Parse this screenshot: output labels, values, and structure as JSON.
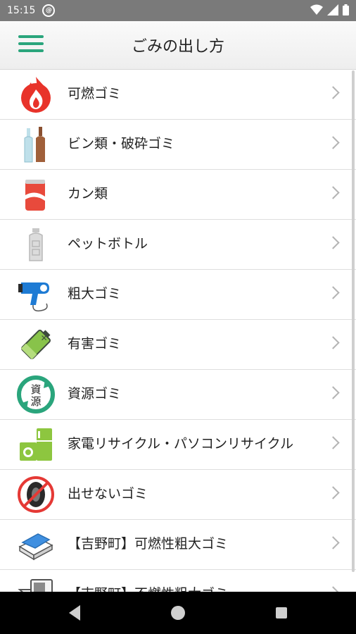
{
  "status_bar": {
    "time": "15:15",
    "sync_glyph": "@"
  },
  "app_bar": {
    "title": "ごみの出し方",
    "menu_icon": "hamburger-menu-icon"
  },
  "list": {
    "items": [
      {
        "label": "可燃ゴミ",
        "icon": "flame-icon"
      },
      {
        "label": "ビン類・破砕ゴミ",
        "icon": "bottles-icon"
      },
      {
        "label": "カン類",
        "icon": "can-icon"
      },
      {
        "label": "ペットボトル",
        "icon": "pet-bottle-icon"
      },
      {
        "label": "粗大ゴミ",
        "icon": "hair-dryer-icon"
      },
      {
        "label": "有害ゴミ",
        "icon": "battery-icon"
      },
      {
        "label": "資源ゴミ",
        "icon": "recycle-resource-icon",
        "icon_text_top": "資",
        "icon_text_bottom": "源"
      },
      {
        "label": "家電リサイクル・パソコンリサイクル",
        "icon": "appliances-icon"
      },
      {
        "label": "出せないゴミ",
        "icon": "prohibited-tire-icon"
      },
      {
        "label": "【吉野町】可燃性粗大ゴミ",
        "icon": "futon-icon"
      },
      {
        "label": "【吉野町】不燃性粗大ゴミ",
        "icon": "microwave-icon"
      }
    ]
  },
  "colors": {
    "accent": "#2aa57c",
    "status_bar": "#7a7a7a",
    "nav_bar": "#000000",
    "flame": "#e8332a"
  }
}
